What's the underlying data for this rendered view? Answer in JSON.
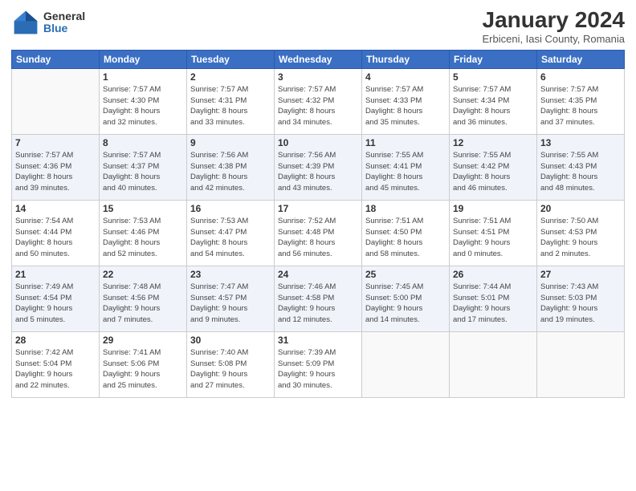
{
  "logo": {
    "general": "General",
    "blue": "Blue"
  },
  "title": "January 2024",
  "subtitle": "Erbiceni, Iasi County, Romania",
  "days_header": [
    "Sunday",
    "Monday",
    "Tuesday",
    "Wednesday",
    "Thursday",
    "Friday",
    "Saturday"
  ],
  "weeks": [
    [
      {
        "num": "",
        "info": ""
      },
      {
        "num": "1",
        "info": "Sunrise: 7:57 AM\nSunset: 4:30 PM\nDaylight: 8 hours\nand 32 minutes."
      },
      {
        "num": "2",
        "info": "Sunrise: 7:57 AM\nSunset: 4:31 PM\nDaylight: 8 hours\nand 33 minutes."
      },
      {
        "num": "3",
        "info": "Sunrise: 7:57 AM\nSunset: 4:32 PM\nDaylight: 8 hours\nand 34 minutes."
      },
      {
        "num": "4",
        "info": "Sunrise: 7:57 AM\nSunset: 4:33 PM\nDaylight: 8 hours\nand 35 minutes."
      },
      {
        "num": "5",
        "info": "Sunrise: 7:57 AM\nSunset: 4:34 PM\nDaylight: 8 hours\nand 36 minutes."
      },
      {
        "num": "6",
        "info": "Sunrise: 7:57 AM\nSunset: 4:35 PM\nDaylight: 8 hours\nand 37 minutes."
      }
    ],
    [
      {
        "num": "7",
        "info": "Sunrise: 7:57 AM\nSunset: 4:36 PM\nDaylight: 8 hours\nand 39 minutes."
      },
      {
        "num": "8",
        "info": "Sunrise: 7:57 AM\nSunset: 4:37 PM\nDaylight: 8 hours\nand 40 minutes."
      },
      {
        "num": "9",
        "info": "Sunrise: 7:56 AM\nSunset: 4:38 PM\nDaylight: 8 hours\nand 42 minutes."
      },
      {
        "num": "10",
        "info": "Sunrise: 7:56 AM\nSunset: 4:39 PM\nDaylight: 8 hours\nand 43 minutes."
      },
      {
        "num": "11",
        "info": "Sunrise: 7:55 AM\nSunset: 4:41 PM\nDaylight: 8 hours\nand 45 minutes."
      },
      {
        "num": "12",
        "info": "Sunrise: 7:55 AM\nSunset: 4:42 PM\nDaylight: 8 hours\nand 46 minutes."
      },
      {
        "num": "13",
        "info": "Sunrise: 7:55 AM\nSunset: 4:43 PM\nDaylight: 8 hours\nand 48 minutes."
      }
    ],
    [
      {
        "num": "14",
        "info": "Sunrise: 7:54 AM\nSunset: 4:44 PM\nDaylight: 8 hours\nand 50 minutes."
      },
      {
        "num": "15",
        "info": "Sunrise: 7:53 AM\nSunset: 4:46 PM\nDaylight: 8 hours\nand 52 minutes."
      },
      {
        "num": "16",
        "info": "Sunrise: 7:53 AM\nSunset: 4:47 PM\nDaylight: 8 hours\nand 54 minutes."
      },
      {
        "num": "17",
        "info": "Sunrise: 7:52 AM\nSunset: 4:48 PM\nDaylight: 8 hours\nand 56 minutes."
      },
      {
        "num": "18",
        "info": "Sunrise: 7:51 AM\nSunset: 4:50 PM\nDaylight: 8 hours\nand 58 minutes."
      },
      {
        "num": "19",
        "info": "Sunrise: 7:51 AM\nSunset: 4:51 PM\nDaylight: 9 hours\nand 0 minutes."
      },
      {
        "num": "20",
        "info": "Sunrise: 7:50 AM\nSunset: 4:53 PM\nDaylight: 9 hours\nand 2 minutes."
      }
    ],
    [
      {
        "num": "21",
        "info": "Sunrise: 7:49 AM\nSunset: 4:54 PM\nDaylight: 9 hours\nand 5 minutes."
      },
      {
        "num": "22",
        "info": "Sunrise: 7:48 AM\nSunset: 4:56 PM\nDaylight: 9 hours\nand 7 minutes."
      },
      {
        "num": "23",
        "info": "Sunrise: 7:47 AM\nSunset: 4:57 PM\nDaylight: 9 hours\nand 9 minutes."
      },
      {
        "num": "24",
        "info": "Sunrise: 7:46 AM\nSunset: 4:58 PM\nDaylight: 9 hours\nand 12 minutes."
      },
      {
        "num": "25",
        "info": "Sunrise: 7:45 AM\nSunset: 5:00 PM\nDaylight: 9 hours\nand 14 minutes."
      },
      {
        "num": "26",
        "info": "Sunrise: 7:44 AM\nSunset: 5:01 PM\nDaylight: 9 hours\nand 17 minutes."
      },
      {
        "num": "27",
        "info": "Sunrise: 7:43 AM\nSunset: 5:03 PM\nDaylight: 9 hours\nand 19 minutes."
      }
    ],
    [
      {
        "num": "28",
        "info": "Sunrise: 7:42 AM\nSunset: 5:04 PM\nDaylight: 9 hours\nand 22 minutes."
      },
      {
        "num": "29",
        "info": "Sunrise: 7:41 AM\nSunset: 5:06 PM\nDaylight: 9 hours\nand 25 minutes."
      },
      {
        "num": "30",
        "info": "Sunrise: 7:40 AM\nSunset: 5:08 PM\nDaylight: 9 hours\nand 27 minutes."
      },
      {
        "num": "31",
        "info": "Sunrise: 7:39 AM\nSunset: 5:09 PM\nDaylight: 9 hours\nand 30 minutes."
      },
      {
        "num": "",
        "info": ""
      },
      {
        "num": "",
        "info": ""
      },
      {
        "num": "",
        "info": ""
      }
    ]
  ]
}
